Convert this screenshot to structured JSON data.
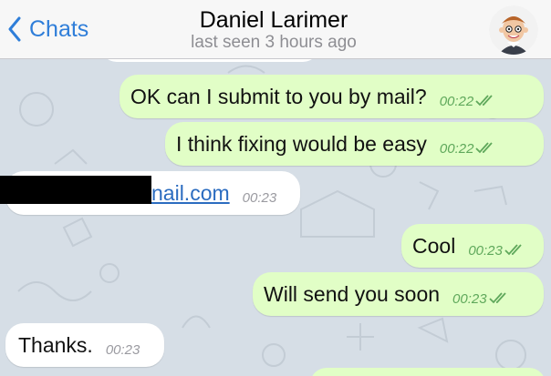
{
  "header": {
    "back_label": "Chats",
    "title": "Daniel Larimer",
    "subtitle": "last seen 3 hours ago"
  },
  "messages": [
    {
      "text": "OK can I submit to you by mail?",
      "time": "00:22",
      "dir": "out"
    },
    {
      "text": "I think fixing would be easy",
      "time": "00:22",
      "dir": "out"
    },
    {
      "text": "nail.com",
      "time": "00:23",
      "dir": "in"
    },
    {
      "text": "Cool",
      "time": "00:23",
      "dir": "out"
    },
    {
      "text": "Will send you soon",
      "time": "00:23",
      "dir": "out"
    },
    {
      "text": "Thanks.",
      "time": "00:23",
      "dir": "in"
    }
  ],
  "colors": {
    "accent": "#2f7ed9",
    "outgoing_bubble": "#e1fec6",
    "incoming_bubble": "#ffffff",
    "check": "#5fa85b"
  }
}
